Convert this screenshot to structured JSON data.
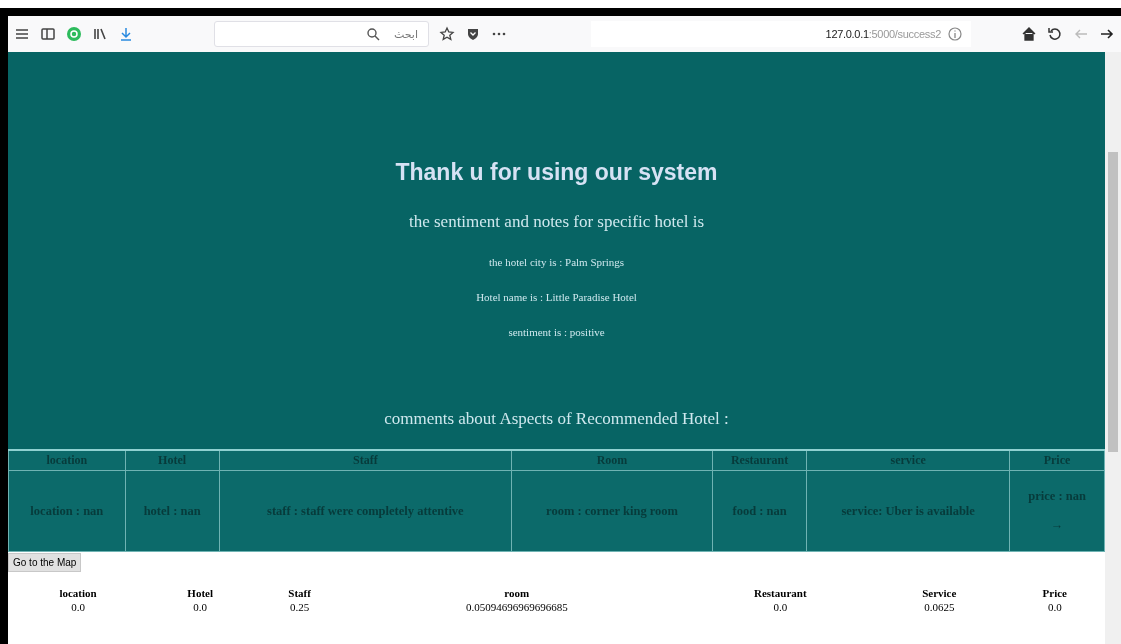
{
  "toolbar": {
    "search": {
      "placeholder": "ابحث"
    },
    "address": {
      "host": "127.0.0.1",
      "path": ":5000/success2"
    },
    "back_disabled": true
  },
  "page": {
    "title": "Thank u for using our system",
    "subtitle": "the sentiment and notes for specific hotel is",
    "details": [
      "the hotel city is : Palm Springs",
      "Hotel name is : Little Paradise Hotel",
      "sentiment is : positive"
    ],
    "comments_heading": "comments about Aspects of Recommended Hotel :",
    "aspects_table": {
      "columns": [
        "location",
        "Hotel",
        "Staff",
        "Room",
        "Restaurant",
        "service",
        "Price"
      ],
      "row": [
        "location : nan",
        "hotel : nan",
        "staff : staff were completely attentive",
        "room : corner king room",
        "food : nan",
        "service: Uber is available",
        "price : nan"
      ],
      "price_arrow": "→"
    },
    "map_button": "Go to the Map",
    "scores_table": {
      "columns": [
        "location",
        "Hotel",
        "Staff",
        "room",
        "Restaurant",
        "Service",
        "Price"
      ],
      "row": [
        "0.0",
        "0.0",
        "0.25",
        "0.05094696969696685",
        "0.0",
        "0.0625",
        "0.0"
      ]
    }
  }
}
